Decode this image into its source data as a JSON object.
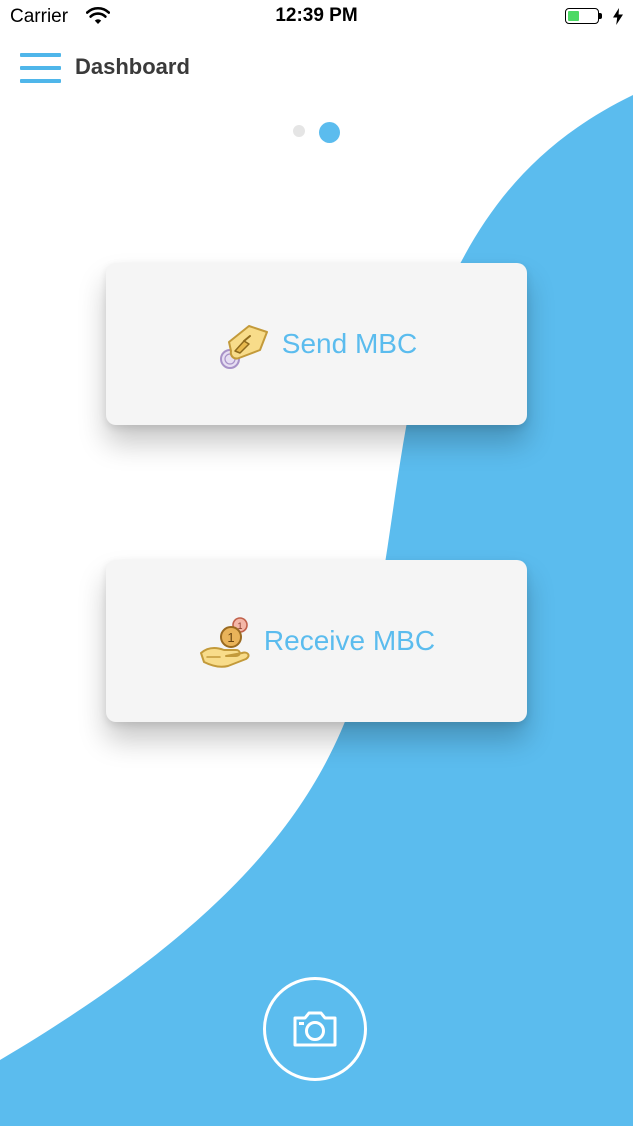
{
  "status_bar": {
    "carrier": "Carrier",
    "time": "12:39 PM",
    "battery_level": 0.3
  },
  "header": {
    "title": "Dashboard",
    "menu_icon": "hamburger-menu-icon"
  },
  "pager": {
    "pages": 2,
    "active_page": 2
  },
  "actions": {
    "send": {
      "label": "Send MBC",
      "icon": "hand-giving-coin-icon"
    },
    "receive": {
      "label": "Receive MBC",
      "icon": "hand-receiving-coins-icon"
    }
  },
  "camera": {
    "icon": "camera-icon"
  },
  "colors": {
    "accent": "#5bbcee",
    "card_background": "#f5f5f5",
    "title_text": "#3a3a3a",
    "background": "#ffffff"
  }
}
